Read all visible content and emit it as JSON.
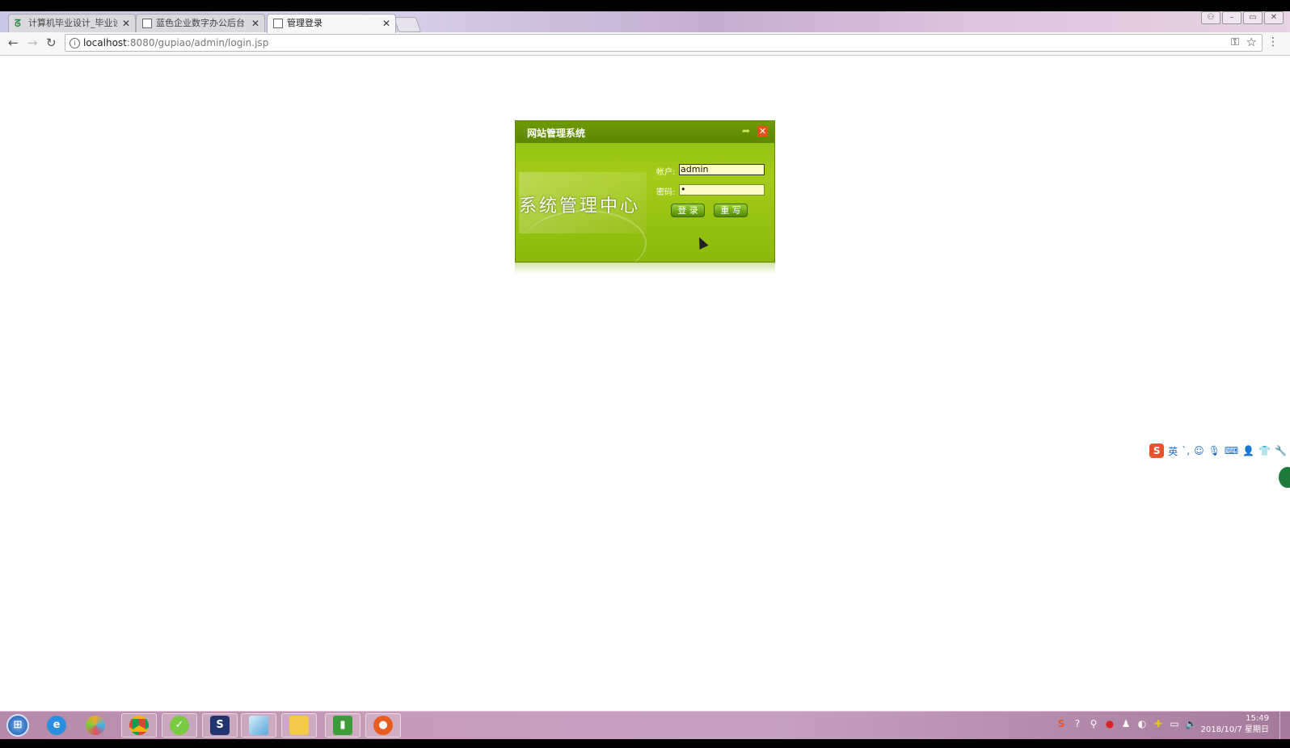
{
  "browser": {
    "tabs": [
      {
        "label": "计算机毕业设计_毕业设计",
        "active": false
      },
      {
        "label": "蓝色企业数字办公后台管",
        "active": false
      },
      {
        "label": "管理登录",
        "active": true
      }
    ],
    "tab_close_glyph": "✕",
    "address_host": "localhost",
    "address_path": ":8080/gupiao/admin/login.jsp",
    "icons": [
      "back-icon",
      "forward-icon",
      "reload-icon",
      "info-icon",
      "key-icon",
      "star-icon",
      "menu-icon"
    ]
  },
  "login": {
    "title": "网站管理系统",
    "banner": "系统管理中心",
    "account_label": "帐户:",
    "account_value": "admin",
    "password_label": "密码:",
    "password_value": "•",
    "login_button": "登 录",
    "reset_button": "重 写",
    "colors": {
      "accent": "#8fbd0e",
      "header": "#5c8700",
      "close": "#e2541a"
    }
  },
  "ime_toolbar": {
    "logo": "S",
    "mode": "英"
  },
  "taskbar": {
    "time": "15:49",
    "date": "2018/10/7 星期日"
  }
}
